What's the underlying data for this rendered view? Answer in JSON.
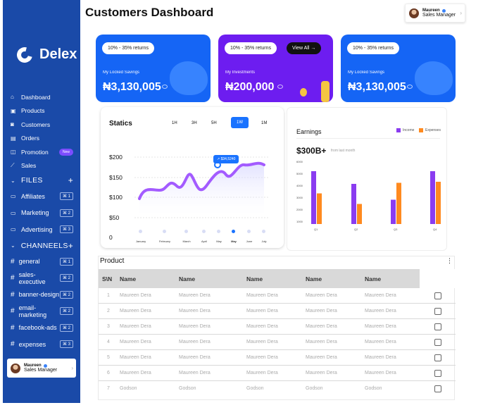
{
  "page_title": "Customers Dashboard",
  "user": {
    "name": "Maureen",
    "role": "Sales Manager"
  },
  "brand": {
    "name": "Delex"
  },
  "sidebar": {
    "nav": [
      {
        "label": "Dashboard",
        "icon": "home-icon"
      },
      {
        "label": "Products",
        "icon": "box-icon"
      },
      {
        "label": "Customers",
        "icon": "users-icon"
      },
      {
        "label": "Orders",
        "icon": "clipboard-icon"
      },
      {
        "label": "Promotion",
        "icon": "tag-icon",
        "badge": "New"
      },
      {
        "label": "Sales",
        "icon": "chart-icon"
      }
    ],
    "files_header": "FILES",
    "files": [
      {
        "label": "Affiliates",
        "shortcut": "⌘ 1"
      },
      {
        "label": "Marketing",
        "shortcut": "⌘ 2"
      },
      {
        "label": "Advertising",
        "shortcut": "⌘ 3"
      }
    ],
    "channels_header": "CHANNEELS",
    "channels": [
      {
        "label": "general",
        "shortcut": "⌘ 1"
      },
      {
        "label": "sales-executive",
        "shortcut": "⌘ 2"
      },
      {
        "label": "banner-design",
        "shortcut": "⌘ 2"
      },
      {
        "label": "email-marketing",
        "shortcut": "⌘ 2"
      },
      {
        "label": "facebook-ads",
        "shortcut": "⌘ 2"
      },
      {
        "label": "expenses",
        "shortcut": "⌘ 3"
      }
    ]
  },
  "cards": [
    {
      "pill": "10% - 35% returns",
      "label": "My Locked Savings",
      "value": "₦3,130,005"
    },
    {
      "pill": "10% - 35% returns",
      "label": "My Investments",
      "value": "₦200,000",
      "button": "View All"
    },
    {
      "pill": "10% - 35% returns",
      "label": "My Locked Savings",
      "value": "₦3,130,005"
    }
  ],
  "colors": {
    "sidebar": "#1a4aa8",
    "card_blue": "#1565f5",
    "card_purple": "#6d1df0",
    "line": "#a35bff",
    "income": "#8a3cf0",
    "expenses": "#ff8a1f",
    "accent": "#1a73ff"
  },
  "statics": {
    "title": "Statics",
    "timeframes": [
      "1H",
      "3H",
      "5H",
      "1W",
      "1M"
    ],
    "active_timeframe": "1W",
    "tooltip": "$34,5240",
    "y_labels": [
      "$200",
      "$150",
      "$100",
      "$50",
      "0"
    ],
    "x_labels": [
      "January",
      "February",
      "March",
      "April",
      "May",
      "May",
      "June",
      "July"
    ]
  },
  "earnings": {
    "title": "Earnings",
    "value": "$300B+",
    "sub": "from last month",
    "legend": [
      "Income",
      "Expenses"
    ],
    "y_labels": [
      "6000",
      "5000",
      "4000",
      "3000",
      "2000",
      "1000"
    ]
  },
  "chart_data": {
    "type": "bar",
    "categories": [
      "Q1",
      "Q2",
      "Q3",
      "Q4"
    ],
    "series": [
      {
        "name": "Income",
        "values": [
          5000,
          3800,
          2300,
          5000
        ]
      },
      {
        "name": "Expenses",
        "values": [
          2900,
          1900,
          3900,
          4000
        ]
      }
    ],
    "ylim": [
      0,
      6000
    ],
    "legend": "top-right"
  },
  "product": {
    "title": "Product",
    "headers": [
      "S\\N",
      "Name",
      "Name",
      "Name",
      "Name",
      "Name"
    ],
    "rows": [
      {
        "sn": "1",
        "cells": [
          "Maureen Dera",
          "Maureen Dera",
          "Maureen Dera",
          "Maureen Dera",
          "Maureen Dera"
        ]
      },
      {
        "sn": "2",
        "cells": [
          "Maureen Dera",
          "Maureen Dera",
          "Maureen Dera",
          "Maureen Dera",
          "Maureen Dera"
        ]
      },
      {
        "sn": "3",
        "cells": [
          "Maureen Dera",
          "Maureen Dera",
          "Maureen Dera",
          "Maureen Dera",
          "Maureen Dera"
        ]
      },
      {
        "sn": "4",
        "cells": [
          "Maureen Dera",
          "Maureen Dera",
          "Maureen Dera",
          "Maureen Dera",
          "Maureen Dera"
        ]
      },
      {
        "sn": "5",
        "cells": [
          "Maureen Dera",
          "Maureen Dera",
          "Maureen Dera",
          "Maureen Dera",
          "Maureen Dera"
        ]
      },
      {
        "sn": "6",
        "cells": [
          "Maureen Dera",
          "Maureen Dera",
          "Maureen Dera",
          "Maureen Dera",
          "Maureen Dera"
        ]
      },
      {
        "sn": "7",
        "cells": [
          "Godson",
          "Godson",
          "Godson",
          "Godson",
          "Godson"
        ]
      }
    ]
  }
}
